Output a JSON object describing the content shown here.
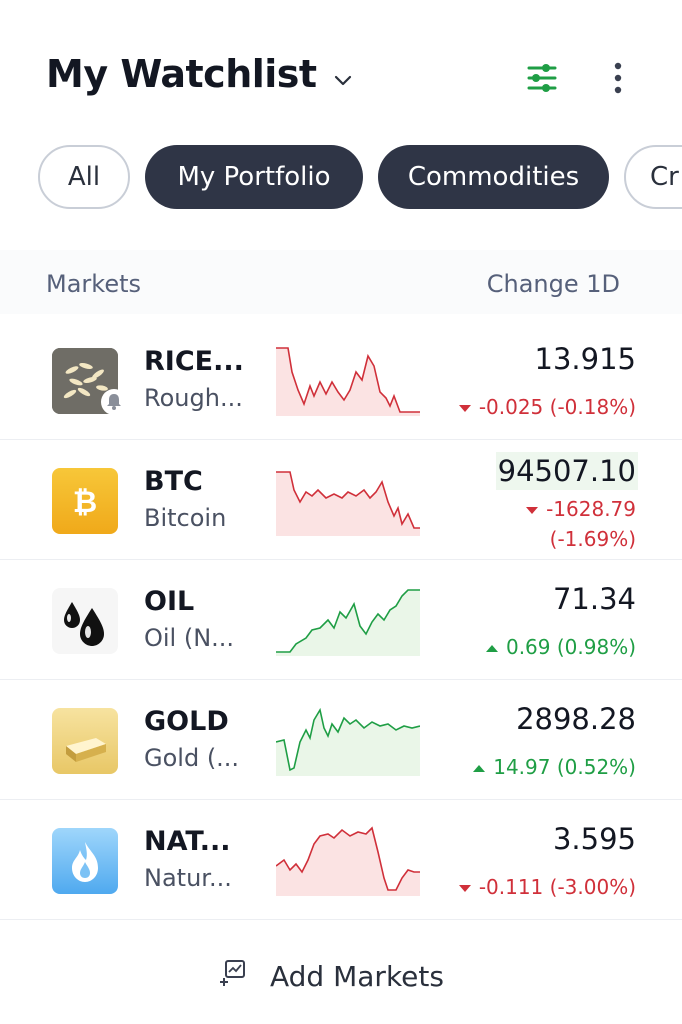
{
  "header": {
    "title": "My Watchlist",
    "icons": {
      "title_dropdown": "chevron-down-icon",
      "filter": "sliders-icon",
      "more": "more-vertical-icon"
    },
    "accent_color": "#1f9e45"
  },
  "tabs": [
    {
      "label": "All",
      "selected": false
    },
    {
      "label": "My Portfolio",
      "selected": true
    },
    {
      "label": "Commodities",
      "selected": true
    },
    {
      "label": "Cr",
      "selected": false
    }
  ],
  "columns": {
    "markets": "Markets",
    "change": "Change 1D"
  },
  "markets": [
    {
      "symbol": "RICE...",
      "name": "Rough...",
      "price": "13.915",
      "change": "-0.025 (-0.18%)",
      "direction": "down",
      "icon": "rice-icon",
      "alert_icon": "bell-icon"
    },
    {
      "symbol": "BTC",
      "name": "Bitcoin",
      "price": "94507.10",
      "change_line1": "-1628.79",
      "change_line2": "(-1.69%)",
      "direction": "down",
      "icon": "bitcoin-icon"
    },
    {
      "symbol": "OIL",
      "name": "Oil (N...",
      "price": "71.34",
      "change": "0.69 (0.98%)",
      "direction": "up",
      "icon": "oil-drops-icon"
    },
    {
      "symbol": "GOLD",
      "name": "Gold (...",
      "price": "2898.28",
      "change": "14.97 (0.52%)",
      "direction": "up",
      "icon": "gold-bar-icon"
    },
    {
      "symbol": "NAT...",
      "name": "Natur...",
      "price": "3.595",
      "change": "-0.111 (-3.00%)",
      "direction": "down",
      "icon": "flame-icon"
    }
  ],
  "colors": {
    "negative": "#d0303a",
    "positive": "#1f9e45",
    "tab_filled": "#2f3546"
  },
  "add_markets": {
    "label": "Add Markets",
    "icon": "add-markets-icon"
  }
}
